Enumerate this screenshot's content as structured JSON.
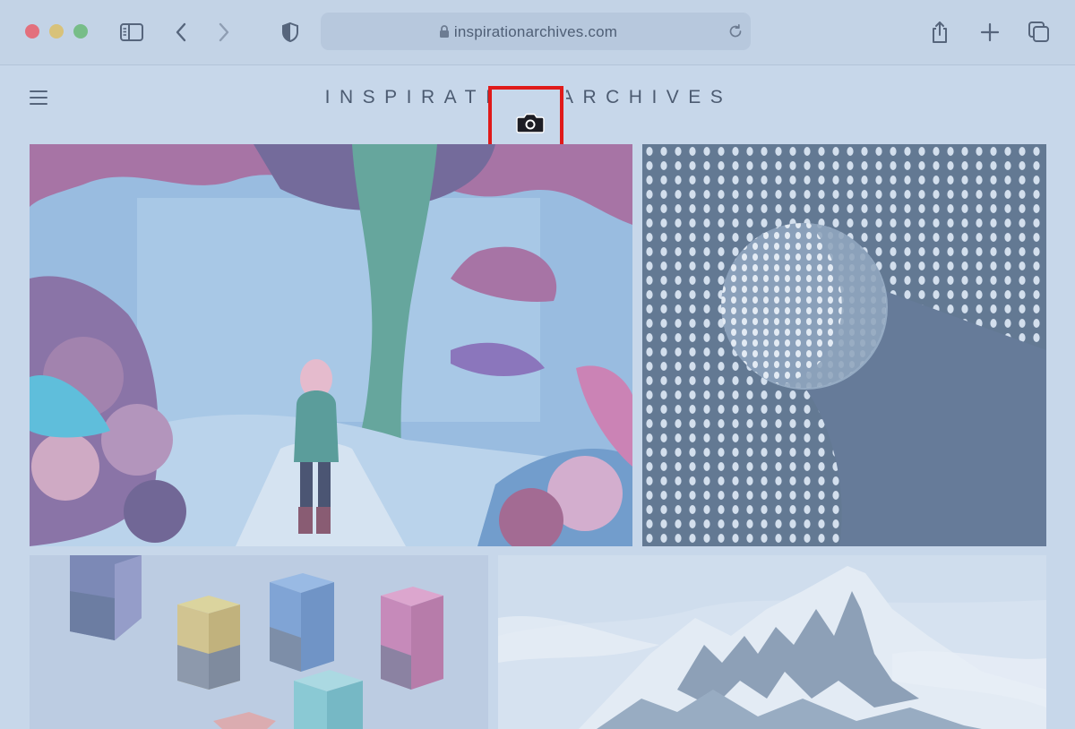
{
  "browser": {
    "url": "inspirationarchives.com",
    "traffic_lights": {
      "close": "#e3707d",
      "minimize": "#d8c27a",
      "maximize": "#77bd88"
    },
    "icons": [
      "sidebar-icon",
      "back-icon",
      "forward-icon",
      "shield-icon",
      "lock-icon",
      "reload-icon",
      "share-icon",
      "new-tab-icon",
      "tabs-overview-icon"
    ]
  },
  "page": {
    "site_title": "INSPIRATION ARCHIVES",
    "menu_icon": "hamburger-icon",
    "overlay_icon": "camera-icon",
    "highlight_color": "#e01a1a"
  },
  "gallery": [
    {
      "subject": "forest-illustration"
    },
    {
      "subject": "dotted-sphere"
    },
    {
      "subject": "floating-cubes"
    },
    {
      "subject": "snowy-mountain"
    }
  ]
}
